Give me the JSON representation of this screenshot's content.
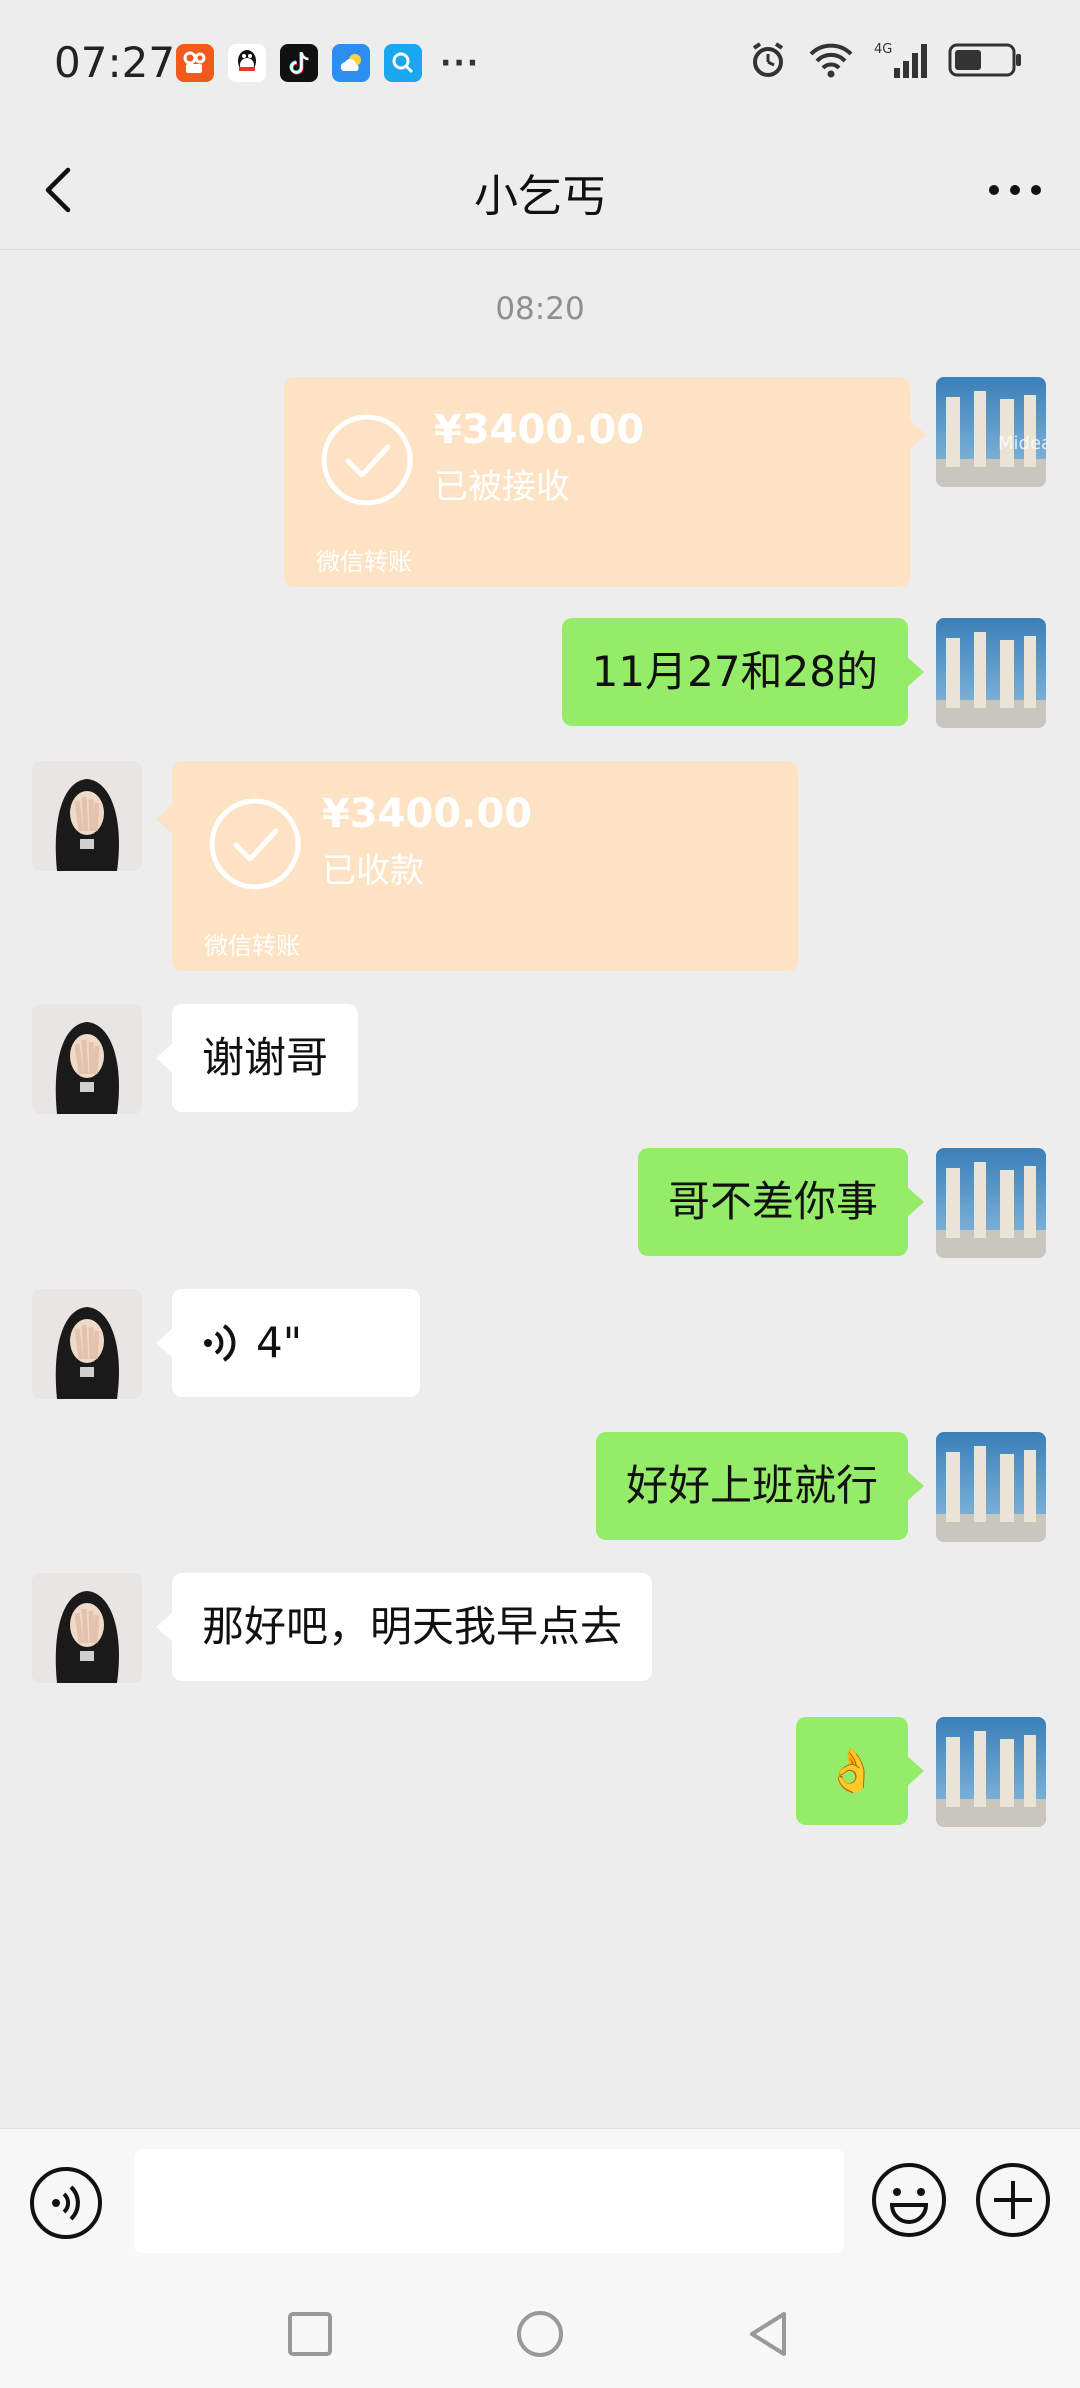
{
  "status_bar": {
    "time": "07:27",
    "more_notifications": "···",
    "network_label": "4G"
  },
  "nav": {
    "title": "小乞丐"
  },
  "chat": {
    "timestamp": "08:20",
    "messages": [
      {
        "sender": "self",
        "type": "transfer",
        "amount": "¥3400.00",
        "status": "已被接收",
        "footer": "微信转账"
      },
      {
        "sender": "self",
        "type": "text",
        "text": "11月27和28的"
      },
      {
        "sender": "other",
        "type": "transfer",
        "amount": "¥3400.00",
        "status": "已收款",
        "footer": "微信转账"
      },
      {
        "sender": "other",
        "type": "text",
        "text": "谢谢哥"
      },
      {
        "sender": "self",
        "type": "text",
        "text": "哥不差你事"
      },
      {
        "sender": "other",
        "type": "voice",
        "duration": "4\""
      },
      {
        "sender": "self",
        "type": "text",
        "text": "好好上班就行"
      },
      {
        "sender": "other",
        "type": "text",
        "text": "那好吧，明天我早点去"
      },
      {
        "sender": "self",
        "type": "emoji",
        "text": "👌"
      }
    ]
  },
  "input_bar": {
    "value": ""
  },
  "colors": {
    "self_bubble": "#95ec69",
    "other_bubble": "#ffffff",
    "transfer_bg": "#fde2c3",
    "background": "#ededed"
  }
}
